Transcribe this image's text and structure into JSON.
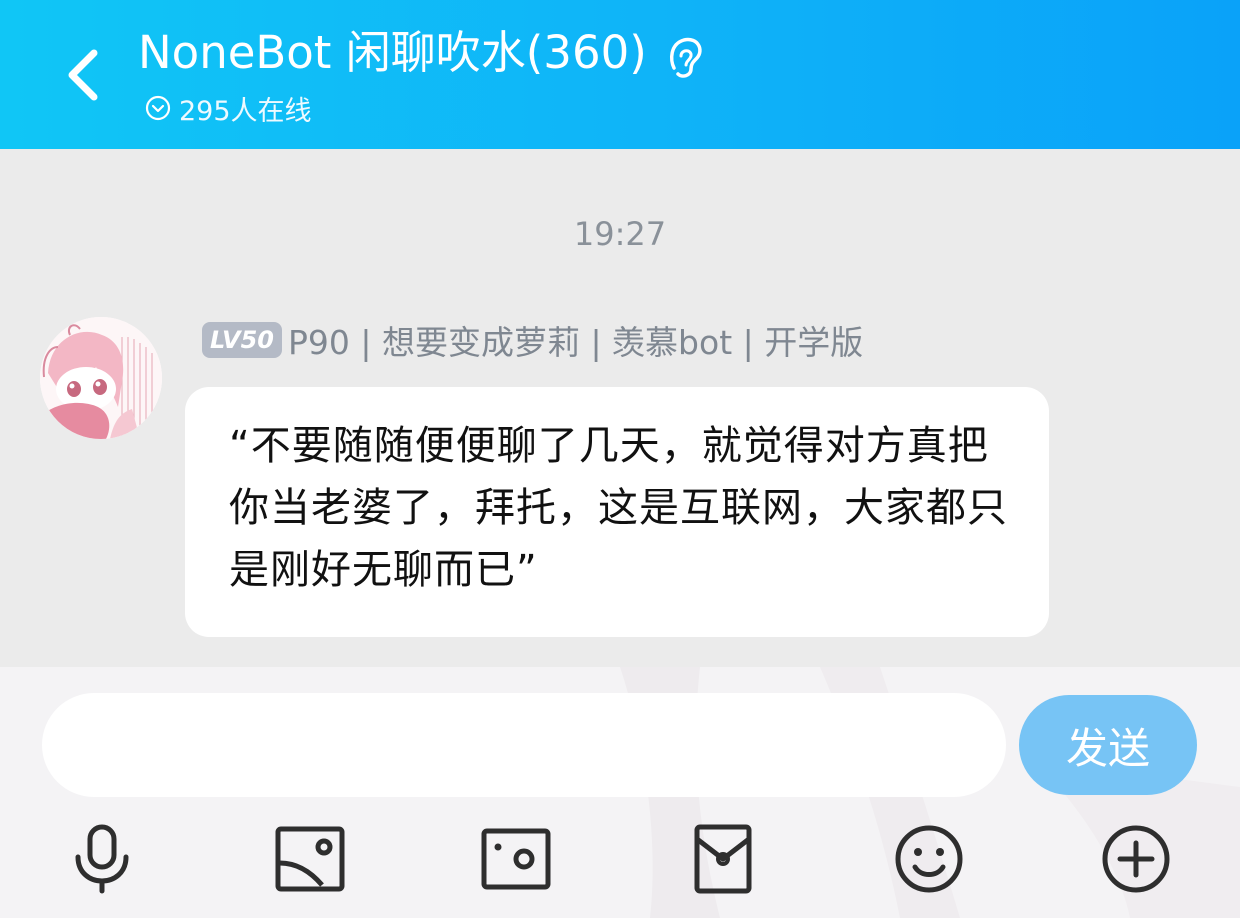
{
  "header": {
    "title": "NoneBot 闲聊吹水(360)",
    "online": "295人在线"
  },
  "chat": {
    "timestamp": "19:27",
    "message": {
      "level_badge": "LV50",
      "sender": "P90 | 想要变成萝莉 | 羡慕bot | 开学版",
      "text": "“不要随随便便聊了几天，就觉得对方真把你当老婆了，拜托，这是互联网，大家都只是刚好无聊而已”"
    }
  },
  "input": {
    "value": "",
    "placeholder": "",
    "send_label": "发送"
  },
  "toolbar": {
    "icons": [
      "microphone-icon",
      "image-icon",
      "camera-icon",
      "red-packet-icon",
      "emoji-icon",
      "plus-icon"
    ]
  },
  "colors": {
    "header_start": "#10c6f6",
    "header_end": "#0aa2f9",
    "send_button": "#77c4f5",
    "level_badge": "#b4bac6"
  }
}
